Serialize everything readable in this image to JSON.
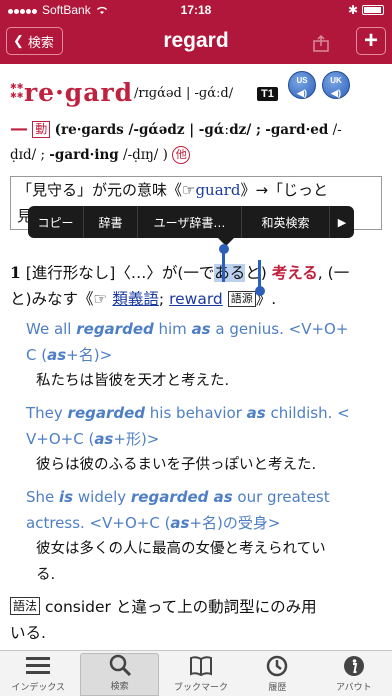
{
  "status_bar": {
    "carrier": "SoftBank",
    "time": "17:18"
  },
  "nav": {
    "back_label": "検索",
    "title": "regard",
    "plus_label": "+"
  },
  "entry": {
    "headword": "re·gard",
    "pronunciation": "/rɪɡάəd | -ɡάːd/",
    "level": "T1",
    "audio": [
      {
        "label": "US"
      },
      {
        "label": "UK"
      }
    ],
    "pos_verb": "動",
    "inflection_line1": "(re·gards /-ɡάədz | -ɡάːdz/ ;",
    "inflection_past": "-gard·ed",
    "inflection_past_pron": "/-",
    "inflection_line2_start": "ḍɪd/ ;",
    "inflection_ing": "-gard·ing",
    "inflection_ing_pron": "/-ḍɪŋ/ )",
    "pos_transitive": "他",
    "origin_text": "「見守る」が元の意味《☞",
    "origin_link": "guard",
    "origin_text2": "》→「じっと",
    "origin_line2": "見…",
    "popup_menu": {
      "items": [
        "コピー",
        "辞書",
        "ユーザ辞書…",
        "和英検索"
      ],
      "more": "▶"
    },
    "sense1": {
      "number": "1",
      "label": "[進行形なし]〈…〉が(一で",
      "selected": "ある",
      "after_selected": "と)",
      "gloss": "考える",
      "line1_end": ", (一",
      "line2": "と)みなす《☞",
      "link1": "類義語",
      "separator": ";",
      "link2": "reward",
      "box": "語源",
      "line2_end": "》."
    },
    "examples": [
      {
        "en_pre": "We all ",
        "en_em": "regarded",
        "en_mid": " him ",
        "en_em2": "as",
        "en_post": " a genius. <V+O+",
        "en_line2": "C (",
        "en_line2_em": "as",
        "en_line2_post": "+名)>",
        "ja": "私たちは皆彼を天才と考えた."
      },
      {
        "en_pre": "They ",
        "en_em": "regarded",
        "en_mid": " his behavior ",
        "en_em2": "as",
        "en_post": " childish. <",
        "en_line2": "V+O+C (",
        "en_line2_em": "as",
        "en_line2_post": "+形)>",
        "ja": "彼らは彼のふるまいを子供っぽいと考えた."
      },
      {
        "en_pre": "She ",
        "en_em": "is",
        "en_mid": " widely ",
        "en_em2": "regarded as",
        "en_post": " our greatest",
        "en_line2": "actress. <V+O+C (",
        "en_line2_em": "as",
        "en_line2_post": "+名)の受身>",
        "ja": "彼女は多くの人に最高の女優と考えられてい",
        "ja_line2": "る."
      }
    ],
    "usage_box": "語法",
    "usage_text": "consider と違って上の動詞型にのみ用",
    "usage_text2": "いる."
  },
  "tabbar": {
    "tabs": [
      {
        "label": "インデックス",
        "icon": "list-icon"
      },
      {
        "label": "検索",
        "icon": "search-icon"
      },
      {
        "label": "ブックマーク",
        "icon": "book-icon"
      },
      {
        "label": "履歴",
        "icon": "clock-icon"
      },
      {
        "label": "アバウト",
        "icon": "info-icon"
      }
    ]
  },
  "colors": {
    "brand": "#b0173a",
    "headword": "#c0213f",
    "example": "#4e7fc6",
    "link": "#1a3aa0"
  }
}
